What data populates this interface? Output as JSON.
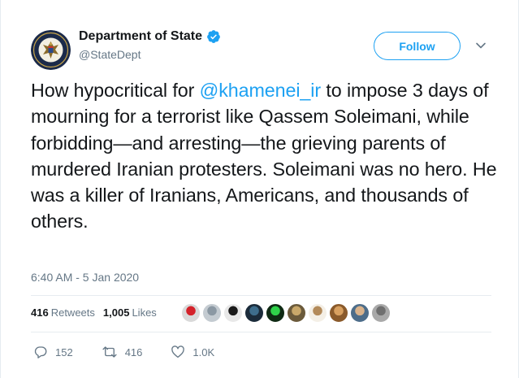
{
  "author": {
    "name": "Department of State",
    "handle": "@StateDept",
    "verified": true
  },
  "follow_label": "Follow",
  "tweet": {
    "text_before": "How hypocritical for ",
    "mention": "@khamenei_ir",
    "text_after": " to impose 3 days of mourning for a terrorist like Qassem Soleimani, while forbidding—and arresting—the grieving parents of murdered Iranian protesters. Soleimani was no hero. He was a killer of Iranians, Americans, and thousands of others."
  },
  "timestamp": "6:40 AM - 5 Jan 2020",
  "stats": {
    "retweets_count": "416",
    "retweets_label": "Retweets",
    "likes_count": "1,005",
    "likes_label": "Likes"
  },
  "liker_avatars": [
    {
      "color": "#d9d9d9",
      "accent": "#d4222a"
    },
    {
      "color": "#c4cbd1",
      "accent": "#8b98a3"
    },
    {
      "color": "#e8e8e8",
      "accent": "#1a1a1a"
    },
    {
      "color": "#1b2b3a",
      "accent": "#3e6d8c"
    },
    {
      "color": "#0f2a14",
      "accent": "#2fd14a"
    },
    {
      "color": "#6b5a3b",
      "accent": "#c9a86a"
    },
    {
      "color": "#f4efe6",
      "accent": "#b38a5a"
    },
    {
      "color": "#8a5a2b",
      "accent": "#d8a060"
    },
    {
      "color": "#4d6d8a",
      "accent": "#d9b38c"
    },
    {
      "color": "#a9a9a9",
      "accent": "#6f6f6f"
    }
  ],
  "actions": {
    "reply_count": "152",
    "retweet_count": "416",
    "like_count": "1.0K"
  },
  "colors": {
    "brand_blue": "#1da1f2",
    "secondary_text": "#657786",
    "primary_text": "#14171a"
  }
}
